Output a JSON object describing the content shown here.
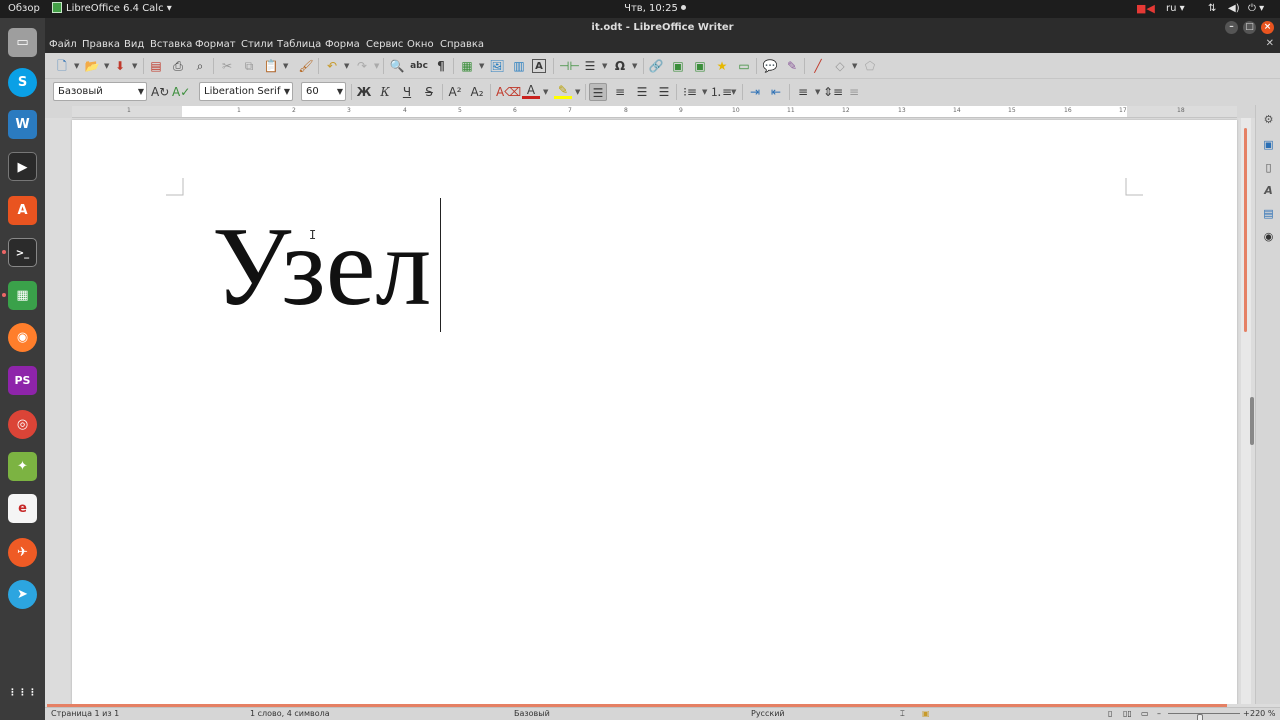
{
  "system_bar": {
    "overview": "Обзор",
    "app_menu": "LibreOffice 6.4 Calc ▾",
    "clock": "Чтв, 10:25",
    "language": "ru ▾",
    "network_icon": "network-icon",
    "volume_icon": "volume-icon",
    "power_icon": "power-icon"
  },
  "dock": {
    "items": [
      {
        "name": "files",
        "glyph": "▭"
      },
      {
        "name": "skype",
        "glyph": "S"
      },
      {
        "name": "writer",
        "glyph": "W"
      },
      {
        "name": "video-editor",
        "glyph": "▶"
      },
      {
        "name": "software-center",
        "glyph": "A"
      },
      {
        "name": "terminal",
        "glyph": ">_"
      },
      {
        "name": "calc",
        "glyph": "▦"
      },
      {
        "name": "firefox",
        "glyph": "◉"
      },
      {
        "name": "phpstorm",
        "glyph": "PS"
      },
      {
        "name": "chrome",
        "glyph": "◎"
      },
      {
        "name": "image-viewer",
        "glyph": "✦"
      },
      {
        "name": "mail-client",
        "glyph": "e"
      },
      {
        "name": "postman",
        "glyph": "✈"
      },
      {
        "name": "telegram",
        "glyph": "➤"
      },
      {
        "name": "show-apps",
        "glyph": "⋮⋮⋮"
      }
    ]
  },
  "window": {
    "title": "it.odt - LibreOffice Writer",
    "menu": [
      "Файл",
      "Правка",
      "Вид",
      "Вставка",
      "Формат",
      "Стили",
      "Таблица",
      "Форма",
      "Сервис",
      "Окно",
      "Справка"
    ]
  },
  "formatting": {
    "paragraph_style": "Базовый",
    "font_name": "Liberation Serif",
    "font_size": "60",
    "bold_label": "Ж",
    "italic_label": "К",
    "underline_label": "Ч",
    "strike_label": "S"
  },
  "document": {
    "text": "Узел"
  },
  "statusbar": {
    "page": "Страница 1 из 1",
    "words": "1 слово, 4 символа",
    "style": "Базовый",
    "language": "Русский",
    "zoom": "220 %"
  },
  "colors": {
    "accent": "#e58064",
    "dock_bg": "#3b3b3b",
    "topbar_bg": "#1d1d1d"
  }
}
